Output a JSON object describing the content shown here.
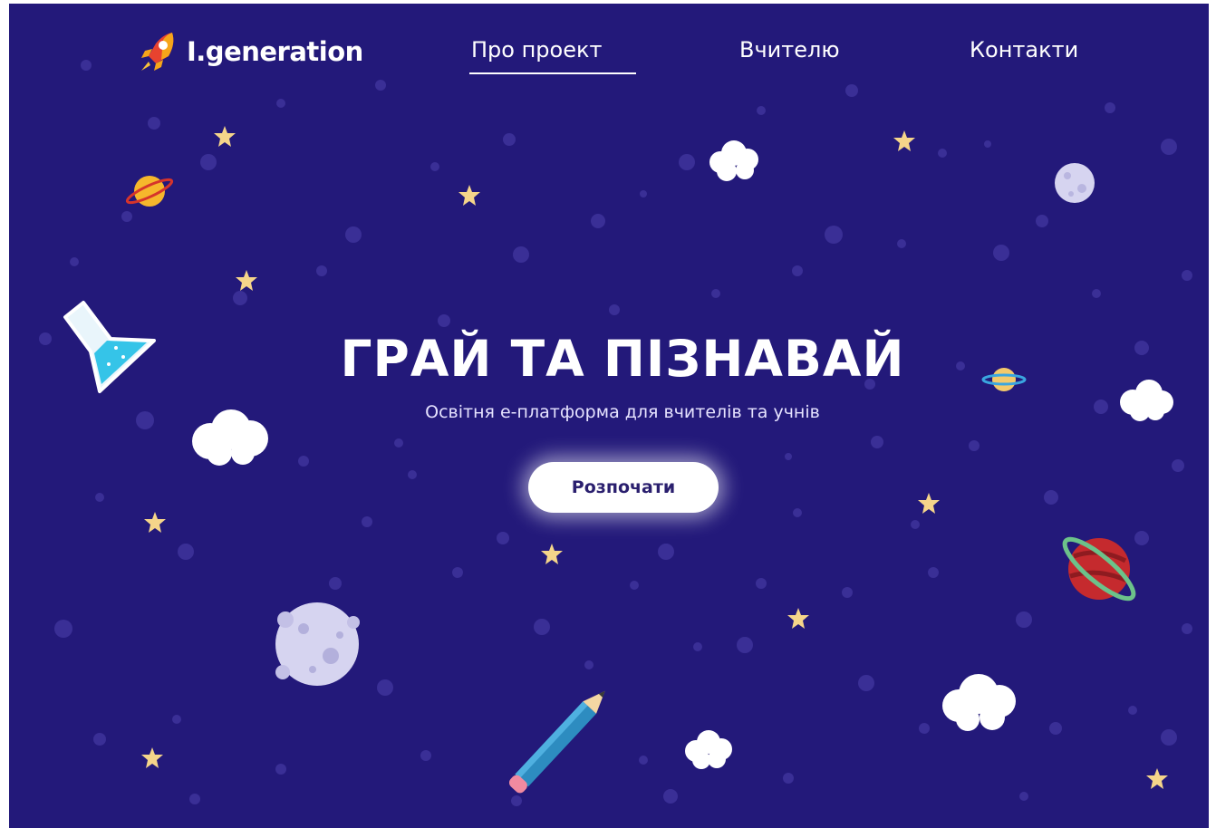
{
  "brand": {
    "name": "I.generation",
    "logo_icon": "rocket-icon"
  },
  "nav": {
    "items": [
      {
        "label": "Про проект",
        "active": true
      },
      {
        "label": "Вчителю",
        "active": false
      },
      {
        "label": "Контакти",
        "active": false
      }
    ]
  },
  "hero": {
    "title": "ГРАЙ ТА ПІЗНАВАЙ",
    "subtitle": "Освітня е-платформа для вчителів та учнів",
    "cta_label": "Розпочати"
  },
  "colors": {
    "background": "#23197a",
    "dot": "#3a2f96",
    "star": "#f5d58a",
    "cloud": "#ffffff",
    "moon": "#d6d4f0",
    "cta_text": "#2a1f6e"
  },
  "decorations": {
    "icons": [
      "star-icon",
      "cloud-icon",
      "planet-icon",
      "moon-icon",
      "flask-icon",
      "pencil-icon"
    ]
  }
}
